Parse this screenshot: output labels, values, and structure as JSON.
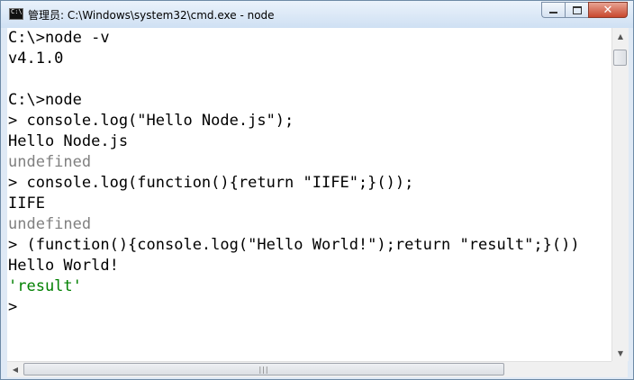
{
  "window": {
    "title": "管理员: C:\\Windows\\system32\\cmd.exe - node",
    "icon": "cmd-icon",
    "buttons": {
      "minimize_icon": "minimize-icon",
      "maximize_icon": "maximize-icon",
      "close_glyph": "✕"
    }
  },
  "console": {
    "lines": [
      {
        "text": "C:\\>node -v",
        "color": "#000000"
      },
      {
        "text": "v4.1.0",
        "color": "#000000"
      },
      {
        "text": "",
        "color": "#000000"
      },
      {
        "text": "C:\\>node",
        "color": "#000000"
      },
      {
        "text": "> console.log(\"Hello Node.js\");",
        "color": "#000000"
      },
      {
        "text": "Hello Node.js",
        "color": "#000000"
      },
      {
        "text": "undefined",
        "color": "#808080"
      },
      {
        "text": "> console.log(function(){return \"IIFE\";}());",
        "color": "#000000"
      },
      {
        "text": "IIFE",
        "color": "#000000"
      },
      {
        "text": "undefined",
        "color": "#808080"
      },
      {
        "text": "> (function(){console.log(\"Hello World!\");return \"result\";}())",
        "color": "#000000"
      },
      {
        "text": "Hello World!",
        "color": "#000000"
      },
      {
        "text": "'result'",
        "color": "#008000"
      },
      {
        "text": ">",
        "color": "#000000"
      }
    ]
  },
  "scrollbars": {
    "up_arrow": "▲",
    "down_arrow": "▼",
    "left_arrow": "◀",
    "right_arrow": "▶",
    "h_thumb_grip": "|||"
  }
}
